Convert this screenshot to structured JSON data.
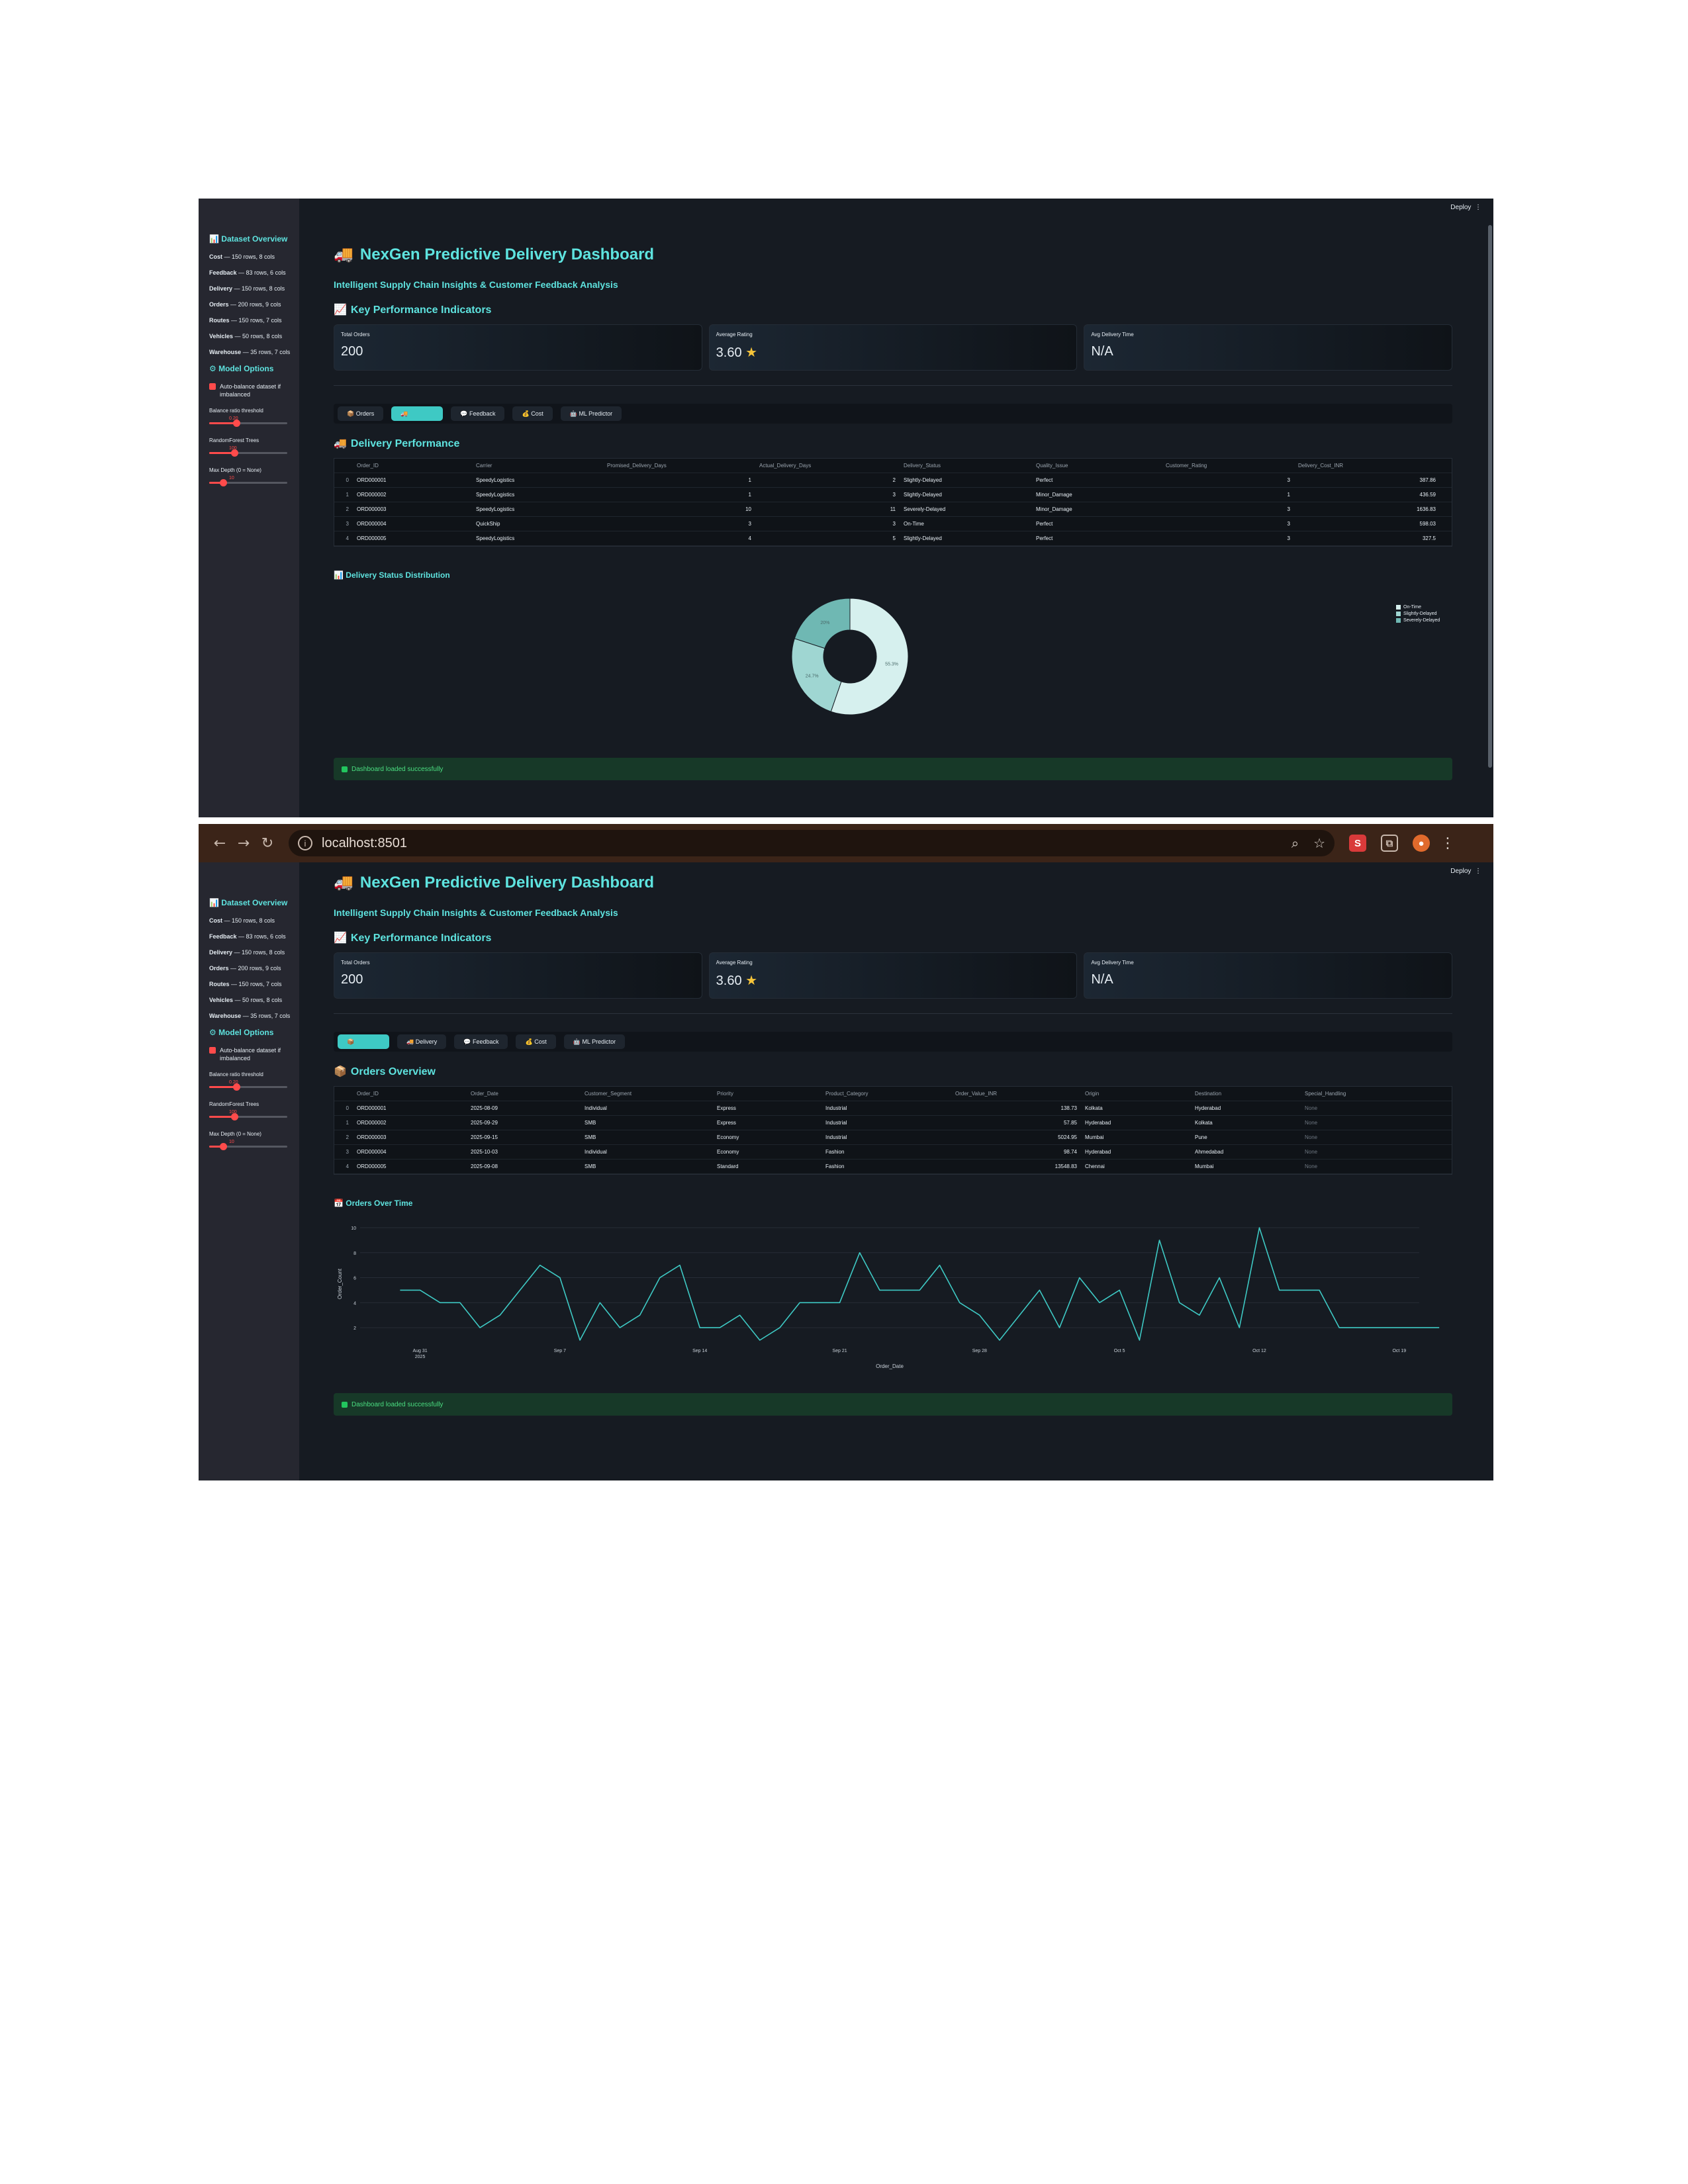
{
  "dashboard": {
    "title": "NexGen Predictive Delivery Dashboard",
    "subtitle": "Intelligent Supply Chain Insights & Customer Feedback Analysis",
    "deploy_label": "Deploy",
    "kpi_heading": "Key Performance Indicators",
    "kpis": [
      {
        "label": "Total Orders",
        "value": "200"
      },
      {
        "label": "Average Rating",
        "value": "3.60"
      },
      {
        "label": "Avg Delivery Time",
        "value": "N/A"
      }
    ],
    "success_message": "Dashboard loaded successfully"
  },
  "sidebar": {
    "title": "Dataset Overview",
    "datasets": [
      {
        "name": "Cost",
        "info": "150 rows, 8 cols"
      },
      {
        "name": "Feedback",
        "info": "83 rows, 6 cols"
      },
      {
        "name": "Delivery",
        "info": "150 rows, 8 cols"
      },
      {
        "name": "Orders",
        "info": "200 rows, 9 cols"
      },
      {
        "name": "Routes",
        "info": "150 rows, 7 cols"
      },
      {
        "name": "Vehicles",
        "info": "50 rows, 8 cols"
      },
      {
        "name": "Warehouse",
        "info": "35 rows, 7 cols"
      }
    ],
    "options_title": "Model Options",
    "checkbox_label": "Auto-balance dataset if imbalanced",
    "sliders": [
      {
        "label": "Balance ratio threshold",
        "value": "0.20",
        "fraction": 0.35
      },
      {
        "label": "RandomForest Trees",
        "value": "100",
        "fraction": 0.32
      },
      {
        "label": "Max Depth (0 = None)",
        "value": "10",
        "fraction": 0.18
      }
    ]
  },
  "tabs": {
    "orders": "Orders",
    "delivery": "Delivery",
    "feedback": "Feedback",
    "cost": "Cost",
    "ml": "ML Predictor"
  },
  "screen1": {
    "section_title": "Delivery Performance",
    "columns": [
      "Order_ID",
      "Carrier",
      "Promised_Delivery_Days",
      "Actual_Delivery_Days",
      "Delivery_Status",
      "Quality_Issue",
      "Customer_Rating",
      "Delivery_Cost_INR"
    ],
    "rows": [
      {
        "idx": "0",
        "cells": [
          "ORD000001",
          "SpeedyLogistics",
          "1",
          "2",
          "Slightly-Delayed",
          "Perfect",
          "3",
          "387.86"
        ]
      },
      {
        "idx": "1",
        "cells": [
          "ORD000002",
          "SpeedyLogistics",
          "1",
          "3",
          "Slightly-Delayed",
          "Minor_Damage",
          "1",
          "436.59"
        ]
      },
      {
        "idx": "2",
        "cells": [
          "ORD000003",
          "SpeedyLogistics",
          "10",
          "11",
          "Severely-Delayed",
          "Minor_Damage",
          "3",
          "1636.83"
        ]
      },
      {
        "idx": "3",
        "cells": [
          "ORD000004",
          "QuickShip",
          "3",
          "3",
          "On-Time",
          "Perfect",
          "3",
          "598.03"
        ]
      },
      {
        "idx": "4",
        "cells": [
          "ORD000005",
          "SpeedyLogistics",
          "4",
          "5",
          "Slightly-Delayed",
          "Perfect",
          "3",
          "327.5"
        ]
      }
    ],
    "chart_title": "Delivery Status Distribution"
  },
  "screen2": {
    "url": "localhost:8501",
    "section_title": "Orders Overview",
    "columns": [
      "Order_ID",
      "Order_Date",
      "Customer_Segment",
      "Priority",
      "Product_Category",
      "Order_Value_INR",
      "Origin",
      "Destination",
      "Special_Handling"
    ],
    "rows": [
      {
        "idx": "0",
        "cells": [
          "ORD000001",
          "2025-08-09",
          "Individual",
          "Express",
          "Industrial",
          "138.73",
          "Kolkata",
          "Hyderabad",
          "None"
        ]
      },
      {
        "idx": "1",
        "cells": [
          "ORD000002",
          "2025-09-29",
          "SMB",
          "Express",
          "Industrial",
          "57.85",
          "Hyderabad",
          "Kolkata",
          "None"
        ]
      },
      {
        "idx": "2",
        "cells": [
          "ORD000003",
          "2025-09-15",
          "SMB",
          "Economy",
          "Industrial",
          "5024.95",
          "Mumbai",
          "Pune",
          "None"
        ]
      },
      {
        "idx": "3",
        "cells": [
          "ORD000004",
          "2025-10-03",
          "Individual",
          "Economy",
          "Fashion",
          "98.74",
          "Hyderabad",
          "Ahmedabad",
          "None"
        ]
      },
      {
        "idx": "4",
        "cells": [
          "ORD000005",
          "2025-09-08",
          "SMB",
          "Standard",
          "Fashion",
          "13548.83",
          "Chennai",
          "Mumbai",
          "None"
        ]
      }
    ],
    "chart_title": "Orders Over Time"
  },
  "chart_data": [
    {
      "type": "pie",
      "title": "Delivery Status Distribution",
      "categories": [
        "On-Time",
        "Slightly-Delayed",
        "Severely-Delayed"
      ],
      "values": [
        55.3,
        24.7,
        20
      ],
      "labels": [
        "55.3%",
        "24.7%",
        "20%"
      ],
      "colors": [
        "#d6f0ee",
        "#9fd6d2",
        "#6fb8b3"
      ],
      "legend": "right"
    },
    {
      "type": "line",
      "title": "Orders Over Time",
      "xlabel": "Order_Date",
      "ylabel": "Order_Count",
      "x_range": [
        "2025-08-28",
        "2025-10-13"
      ],
      "x_tick_labels": [
        "Aug 31\n2025",
        "Sep 7",
        "Sep 14",
        "Sep 21",
        "Sep 28",
        "Oct 5",
        "Oct 12",
        "Oct 19"
      ],
      "y_ticks": [
        2,
        4,
        6,
        8,
        10
      ],
      "ylim": [
        1,
        10
      ],
      "x": [
        "2025-08-30",
        "2025-08-31",
        "2025-09-01",
        "2025-09-02",
        "2025-09-03",
        "2025-09-04",
        "2025-09-05",
        "2025-09-06",
        "2025-09-07",
        "2025-09-08",
        "2025-09-09",
        "2025-09-10",
        "2025-09-11",
        "2025-09-12",
        "2025-09-13",
        "2025-09-14",
        "2025-09-15",
        "2025-09-16",
        "2025-09-17",
        "2025-09-18",
        "2025-09-19",
        "2025-09-20",
        "2025-09-21",
        "2025-09-22",
        "2025-09-23",
        "2025-09-24",
        "2025-09-25",
        "2025-09-26",
        "2025-09-27",
        "2025-09-28",
        "2025-09-29",
        "2025-09-30",
        "2025-10-01",
        "2025-10-02",
        "2025-10-03",
        "2025-10-04",
        "2025-10-05",
        "2025-10-06",
        "2025-10-07",
        "2025-10-08",
        "2025-10-09",
        "2025-10-10",
        "2025-10-11",
        "2025-10-12",
        "2025-10-13",
        "2025-10-14",
        "2025-10-15",
        "2025-10-16",
        "2025-10-17",
        "2025-10-18",
        "2025-10-19",
        "2025-10-20",
        "2025-10-21"
      ],
      "values": [
        5,
        5,
        4,
        4,
        2,
        3,
        5,
        7,
        6,
        1,
        4,
        2,
        3,
        6,
        7,
        2,
        2,
        3,
        1,
        2,
        4,
        4,
        4,
        8,
        5,
        5,
        5,
        7,
        4,
        3,
        1,
        3,
        5,
        2,
        6,
        4,
        5,
        1,
        9,
        4,
        3,
        6,
        2,
        10,
        5,
        5,
        5,
        2,
        2,
        2,
        2,
        2,
        2
      ]
    }
  ]
}
